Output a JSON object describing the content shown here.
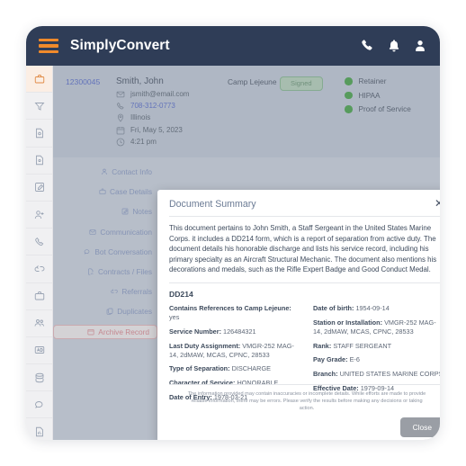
{
  "navbar": {
    "brand": "SimplyConvert",
    "icons": [
      "phone-icon",
      "bell-icon",
      "user-icon"
    ],
    "menu_icon": "hamburger-icon",
    "bg_color": "#2f3d57",
    "accent_color": "#f08a2b"
  },
  "rail": {
    "items": [
      {
        "icon": "briefcase-icon",
        "active": true
      },
      {
        "icon": "funnel-icon",
        "active": false
      },
      {
        "icon": "document-search-icon",
        "active": false
      },
      {
        "icon": "document-lock-icon",
        "active": false
      },
      {
        "icon": "edit-note-icon",
        "active": false
      },
      {
        "icon": "add-user-icon",
        "active": false
      },
      {
        "icon": "phone-icon",
        "active": false
      },
      {
        "icon": "share-icon",
        "active": false
      },
      {
        "icon": "briefcase-alt-icon",
        "active": false
      },
      {
        "icon": "users-icon",
        "active": false
      },
      {
        "icon": "ad-icon",
        "active": false
      },
      {
        "icon": "database-icon",
        "active": false
      },
      {
        "icon": "chat-icon",
        "active": false
      },
      {
        "icon": "report-icon",
        "active": false
      },
      {
        "icon": "gear-icon",
        "active": false
      }
    ]
  },
  "case": {
    "id": "12300045",
    "name": "Smith, John",
    "email": "jsmith@email.com",
    "phone": "708-312-0773",
    "state": "Illinois",
    "date": "Fri, May 5, 2023",
    "time": "4:21 pm",
    "camp": "Camp Lejeune",
    "status_badge": "Signed",
    "flags": [
      {
        "label": "Retainer",
        "color": "#49a84b"
      },
      {
        "label": "HIPAA",
        "color": "#49a84b"
      },
      {
        "label": "Proof of Service",
        "color": "#49a84b"
      }
    ]
  },
  "tabs": [
    {
      "label": "Contact Info",
      "icon": "person-icon",
      "active": false
    },
    {
      "label": "Case Details",
      "icon": "briefcase-icon",
      "active": false
    },
    {
      "label": "Notes",
      "icon": "pencil-square-icon",
      "active": false
    },
    {
      "label": "Communication",
      "icon": "envelope-icon",
      "active": false
    },
    {
      "label": "Bot Conversation",
      "icon": "chat-bubble-icon",
      "active": false
    },
    {
      "label": "Contracts / Files",
      "icon": "file-signature-icon",
      "active": false
    },
    {
      "label": "Referrals",
      "icon": "share-icon",
      "active": false
    },
    {
      "label": "Duplicates",
      "icon": "copy-icon",
      "active": false
    },
    {
      "label": "Archive Record",
      "icon": "archive-icon",
      "active": true
    }
  ],
  "modal": {
    "title": "Document Summary",
    "close_icon": "close-icon",
    "summary": "This document pertains to John Smith, a Staff Sergeant in the United States Marine Corps. it includes a DD214 form, which is a report of separation from active duty. The document details his honorable discharge and lists his service record, including his primary specialty as an Aircraft Structural Mechanic. The document also mentions his decorations and medals, such as the Rifle Expert Badge and Good Conduct Medal.",
    "doc_type": "DD214",
    "fields_left": [
      {
        "label": "Contains References to Camp Lejeune:",
        "value": "yes"
      },
      {
        "label": "Service Number:",
        "value": "126484321"
      },
      {
        "label": "Last Duty Assignment:",
        "value": "VMGR-252 MAG-14, 2dMAW, MCAS, CPNC, 28533"
      },
      {
        "label": "Type of Separation:",
        "value": "DISCHARGE"
      },
      {
        "label": "Character of Service:",
        "value": "HONORABLE"
      },
      {
        "label": "Date of Entry:",
        "value": "1978-03-21"
      }
    ],
    "fields_right": [
      {
        "label": "Date of birth:",
        "value": "1954-09-14"
      },
      {
        "label": "Station or Installation:",
        "value": "VMGR-252 MAG-14, 2dMAW, MCAS, CPNC, 28533"
      },
      {
        "label": "Rank:",
        "value": "STAFF SERGEANT"
      },
      {
        "label": "Pay Grade:",
        "value": "E-6"
      },
      {
        "label": "Branch:",
        "value": "UNITED STATES MARINE CORPS"
      },
      {
        "label": "Effective Date:",
        "value": "1979-09-14"
      }
    ],
    "disclaimer": "The information provided may contain inaccuracies or incomplete details. While efforts are made to provide reliable information, there may be errors. Please verify the results before making any decisions or taking action.",
    "close_button": "Close"
  }
}
